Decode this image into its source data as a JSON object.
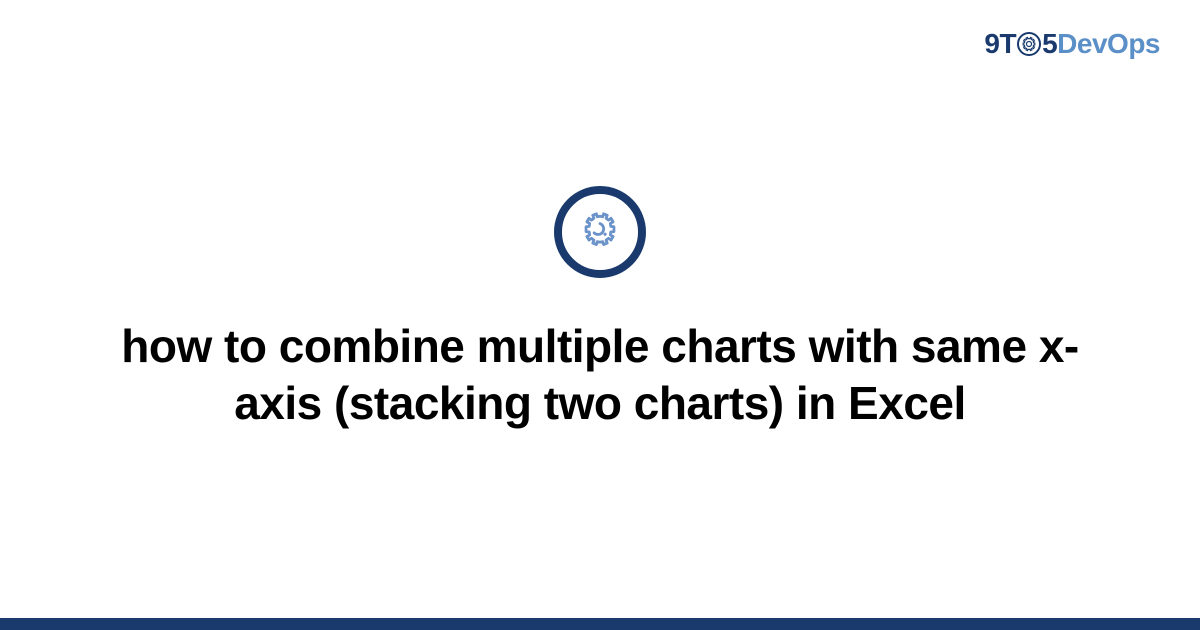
{
  "logo": {
    "part1": "9T",
    "part2": "5",
    "part3": "DevOps"
  },
  "icon": {
    "name": "gear-icon"
  },
  "title": "how to combine multiple charts with same x-axis (stacking two charts) in Excel",
  "colors": {
    "primary": "#1a3a6e",
    "accent": "#5b8fc7",
    "gear": "#6b93c9"
  }
}
